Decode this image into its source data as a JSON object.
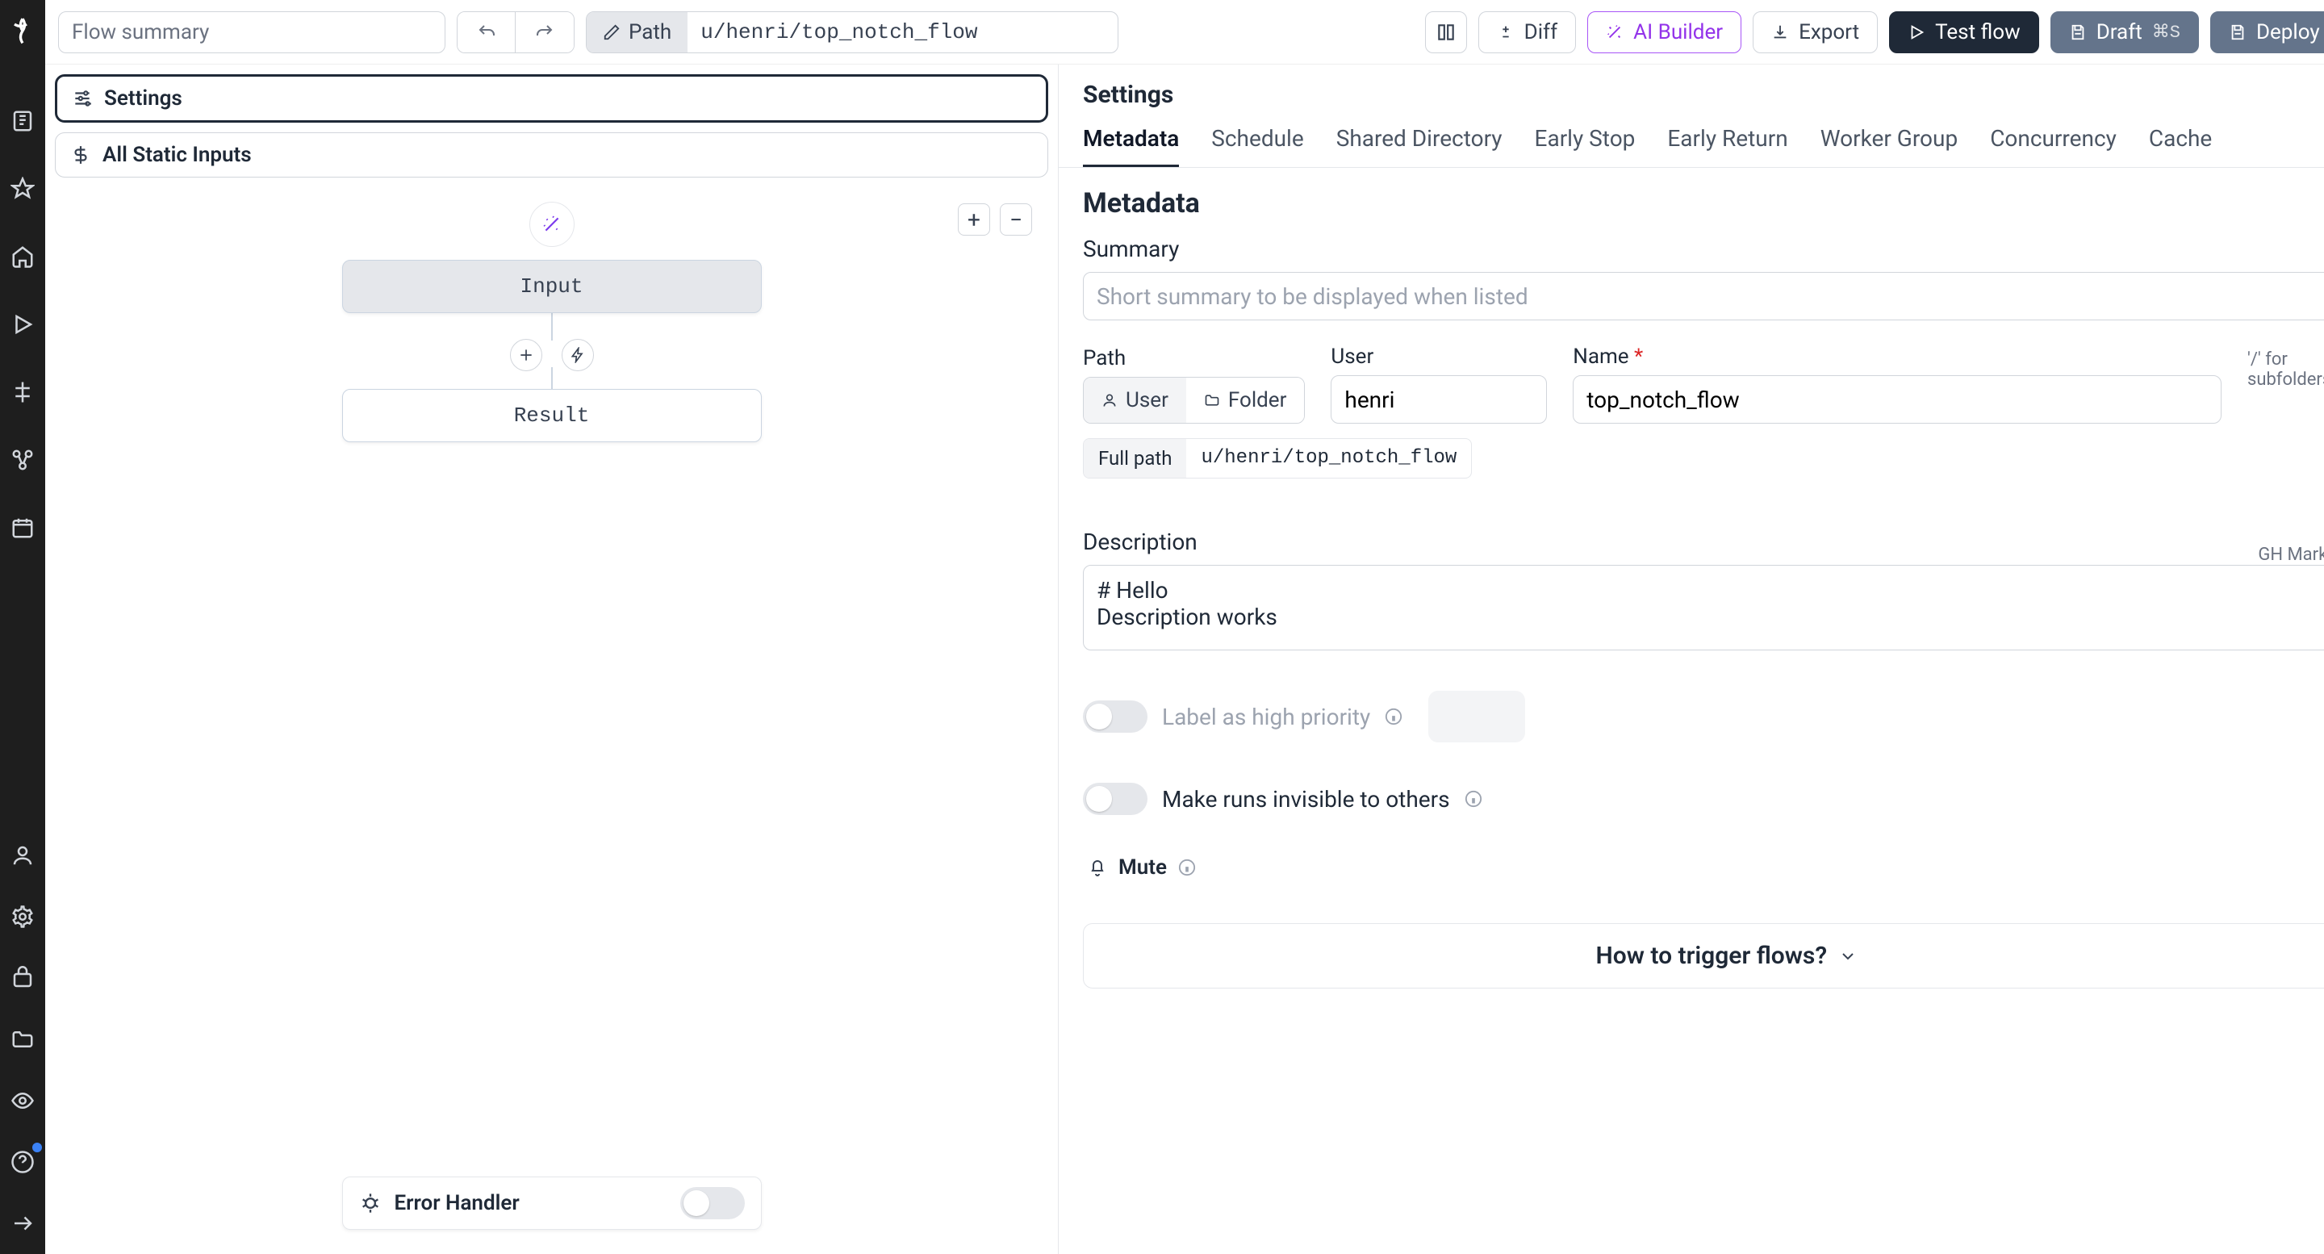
{
  "topbar": {
    "summary_placeholder": "Flow summary",
    "path_label": "Path",
    "path_value": "u/henri/top_notch_flow",
    "diff_label": "Diff",
    "ai_label": "AI Builder",
    "export_label": "Export",
    "test_label": "Test flow",
    "draft_label": "Draft",
    "draft_kbd": "⌘S",
    "deploy_label": "Deploy"
  },
  "canvas": {
    "settings_label": "Settings",
    "static_inputs_label": "All Static Inputs",
    "input_node": "Input",
    "result_node": "Result",
    "error_handler_label": "Error Handler"
  },
  "settings": {
    "header": "Settings",
    "tabs": [
      "Metadata",
      "Schedule",
      "Shared Directory",
      "Early Stop",
      "Early Return",
      "Worker Group",
      "Concurrency",
      "Cache"
    ],
    "active_tab": "Metadata"
  },
  "metadata": {
    "heading": "Metadata",
    "summary_label": "Summary",
    "summary_placeholder": "Short summary to be displayed when listed",
    "path_label": "Path",
    "seg_user": "User",
    "seg_folder": "Folder",
    "user_label": "User",
    "user_value": "henri",
    "name_label": "Name",
    "name_value": "top_notch_flow",
    "name_hint": "'/' for subfolders",
    "fullpath_label": "Full path",
    "fullpath_value": "u/henri/top_notch_flow",
    "description_label": "Description",
    "description_hint": "GH Markdown",
    "description_value": "# Hello\nDescription works",
    "priority_label": "Label as high priority",
    "invisible_label": "Make runs invisible to others",
    "mute_label": "Mute",
    "howto_label": "How to trigger flows?"
  }
}
